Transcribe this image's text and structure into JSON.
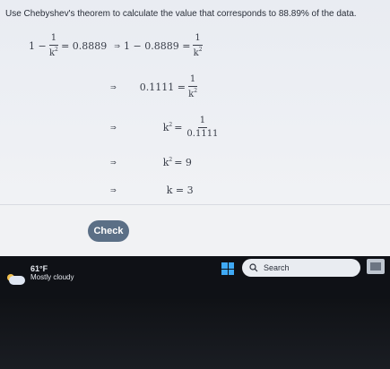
{
  "question": {
    "text": "Use Chebyshev's theorem to calculate the value that corresponds to 88.89% of the data."
  },
  "solution": {
    "step1": {
      "lhs_a": "1 −",
      "frac_num": "1",
      "frac_den": "k",
      "eq": "= 0.8889",
      "arrow": "⇒",
      "mid": "1 − 0.8889 =",
      "rhs_num": "1",
      "rhs_den": "k"
    },
    "step2": {
      "arrow": "⇒",
      "left": "0.1111 =",
      "rhs_num": "1",
      "rhs_den": "k"
    },
    "step3": {
      "arrow": "⇒",
      "left": "k",
      "eq": "=",
      "rhs_num": "1",
      "rhs_den": "0.1111"
    },
    "step4": {
      "arrow": "⇒",
      "left": "k",
      "eq": "= 9"
    },
    "step5": {
      "arrow": "⇒",
      "text": "k = 3"
    }
  },
  "exponent": "2",
  "check_button": {
    "label": "Check"
  },
  "taskbar": {
    "weather_temp": "61°F",
    "weather_condition": "Mostly cloudy",
    "search_label": "Search"
  }
}
